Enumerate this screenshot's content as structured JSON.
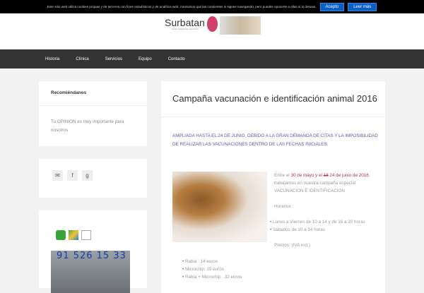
{
  "cookie": {
    "text": "Este sitio web utiliza cookies propias y de terceros con fines estadísticos y de analítica web. Asumimos que las consientes si sigues navegando, pero puedes oponerte a ellas si lo deseas.",
    "accept": "Acepto",
    "more": "Leer más"
  },
  "logo": {
    "name": "Surbatan",
    "subtitle": "centro asistencial veterinario"
  },
  "nav": [
    "Historia",
    "Clínica",
    "Servicios",
    "Equipo",
    "Contacto"
  ],
  "sidebar": {
    "recommend_title": "Recomiéndanos",
    "recommend_text": "Tu OPINION es muy importante para nosotros",
    "social": [
      "email",
      "facebook",
      "google-plus"
    ],
    "contact_icons": [
      "phone",
      "maps",
      "mail"
    ],
    "phone": "91 526 15 33"
  },
  "post": {
    "title": "Campaña vacunación e identificación animal 2016",
    "notice": "AMPLIADA HASTA EL 24 DE JUNIO, DEBIDO A LA GRAN DEMANDA DE CITAS Y LA IMPOSIBILIDAD DE REALIZAR LAS VACUNACIONES DENTRO DE LAS FECHAS INICIALES.",
    "intro_a": "Entre el ",
    "intro_dates": "30 de mayo y el ",
    "intro_struck": "18",
    "intro_new": " 24 de junio de 2016",
    "intro_b": ", trabajamos en nuestra campaña especial VACUNACION  E IDENTIFICACION",
    "hours_label": "Horarios :",
    "hours": [
      "Lunes a Viernes de 10 a 14 y de 16 a 20  horas",
      "Sábados de 10 a 14 horas"
    ],
    "prices_label": "Precios:  (IVA incl.)",
    "prices": [
      "Rabia : 14 euros",
      "Microchip: 19 euros",
      "Rabia + Microchip : 32 euros"
    ]
  }
}
